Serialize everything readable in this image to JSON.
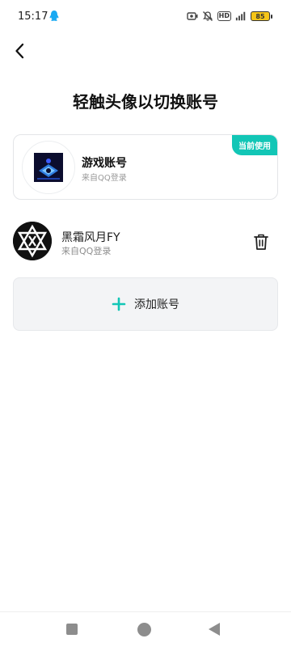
{
  "status_bar": {
    "time": "15:17",
    "hd_label": "HD",
    "battery_level": "85",
    "icons": [
      "qq-icon",
      "screen-record-icon",
      "mute-icon",
      "hd-icon",
      "signal-icon",
      "battery-icon"
    ]
  },
  "header": {
    "back_icon": "chevron-left-icon",
    "title": "轻触头像以切换账号"
  },
  "current_account": {
    "badge": "当前使用",
    "name": "游戏账号",
    "source": "来自QQ登录"
  },
  "accounts": [
    {
      "name": "黑霜风月FY",
      "source": "来自QQ登录",
      "action_icon": "trash-icon"
    }
  ],
  "add_account": {
    "label": "添加账号",
    "icon": "plus-icon"
  },
  "colors": {
    "accent": "#12c6b6",
    "card_border": "#e3e5e8",
    "add_bg": "#f3f4f6",
    "battery": "#f5c518"
  },
  "nav_bar": {
    "icons": [
      "recent-apps-icon",
      "home-icon",
      "back-icon"
    ]
  }
}
